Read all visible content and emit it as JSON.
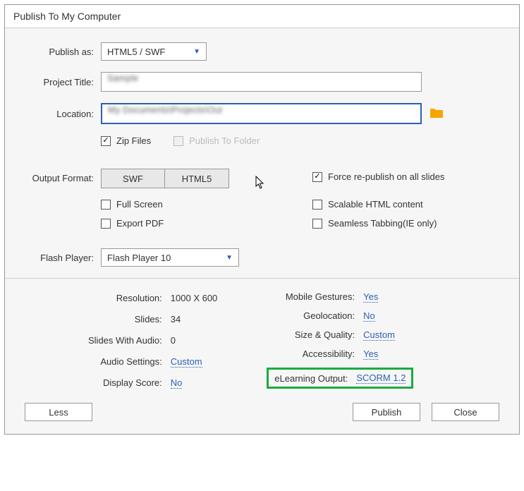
{
  "title": "Publish To My Computer",
  "labels": {
    "publish_as": "Publish as:",
    "project_title": "Project Title:",
    "location": "Location:",
    "output_format": "Output Format:",
    "flash_player": "Flash Player:"
  },
  "publish_as": {
    "value": "HTML5 / SWF"
  },
  "project_title": {
    "value": "Sample"
  },
  "location": {
    "value": "My Documents\\Projects\\Out"
  },
  "checkboxes": {
    "zip_files": "Zip Files",
    "publish_to_folder": "Publish To Folder",
    "full_screen": "Full Screen",
    "export_pdf": "Export PDF",
    "force_republish": "Force re-publish on all slides",
    "scalable_html": "Scalable HTML content",
    "seamless_tabbing": "Seamless Tabbing(IE only)"
  },
  "output_format": {
    "swf": "SWF",
    "html5": "HTML5"
  },
  "flash_player": {
    "value": "Flash Player 10"
  },
  "summary": {
    "resolution_label": "Resolution:",
    "resolution_value": "1000 X 600",
    "slides_label": "Slides:",
    "slides_value": "34",
    "slides_audio_label": "Slides With Audio:",
    "slides_audio_value": "0",
    "audio_settings_label": "Audio Settings:",
    "audio_settings_value": "Custom",
    "display_score_label": "Display Score:",
    "display_score_value": "No",
    "mobile_gestures_label": "Mobile Gestures:",
    "mobile_gestures_value": "Yes",
    "geolocation_label": "Geolocation:",
    "geolocation_value": "No",
    "size_quality_label": "Size & Quality:",
    "size_quality_value": "Custom",
    "accessibility_label": "Accessibility:",
    "accessibility_value": "Yes",
    "elearning_label": "eLearning Output:",
    "elearning_value": "SCORM 1.2"
  },
  "buttons": {
    "less": "Less",
    "publish": "Publish",
    "close": "Close"
  }
}
